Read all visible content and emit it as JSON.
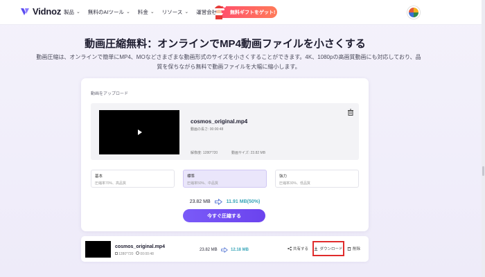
{
  "brand": {
    "name": "Vidnoz",
    "accent": "#6b43ee"
  },
  "nav": {
    "items": [
      {
        "label": "製品"
      },
      {
        "label": "無料のAIツール"
      },
      {
        "label": "料金"
      },
      {
        "label": "リソース"
      },
      {
        "label": "運営会社"
      }
    ],
    "promo_label": "無料ギフトをゲット!"
  },
  "hero": {
    "title": "動画圧縮無料：オンラインでMP4動画ファイルを小さくする",
    "subtitle_line1": "動画圧縮は、オンラインで簡単にMP4、MOなどさまざまな動画形式のサイズを小さくすることができます。4K、1080pの高画質動画にも対応しており、品",
    "subtitle_line2": "質を保ちながら無料で動画ファイルを大幅に縮小します。"
  },
  "uploader": {
    "label": "動画をアップロード",
    "file": {
      "name": "cosmos_original.mp4",
      "duration": "動画の長さ: 00:00:48",
      "resolution": "解像度: 1280*720",
      "size": "動画サイズ: 23.82 MB"
    },
    "options": [
      {
        "title": "基本",
        "desc": "圧縮率70%、高品質",
        "selected": false
      },
      {
        "title": "標準",
        "desc": "圧縮率50%、中品質",
        "selected": true
      },
      {
        "title": "強力",
        "desc": "圧縮率30%、低品質",
        "selected": false
      }
    ],
    "original_size": "23.82 MB",
    "compressed_size": "11.91 MB(50%)",
    "compress_button": "今すぐ圧縮する"
  },
  "result": {
    "name": "cosmos_original.mp4",
    "resolution": "1280*720",
    "duration": "00:00:48",
    "original_size": "23.82 MB",
    "new_size": "12.18 MB",
    "share_label": "共有する",
    "download_label": "ダウンロード",
    "delete_label": "削除"
  },
  "colors": {
    "teal": "#3aa6b9",
    "highlight": "#e02b2b"
  }
}
